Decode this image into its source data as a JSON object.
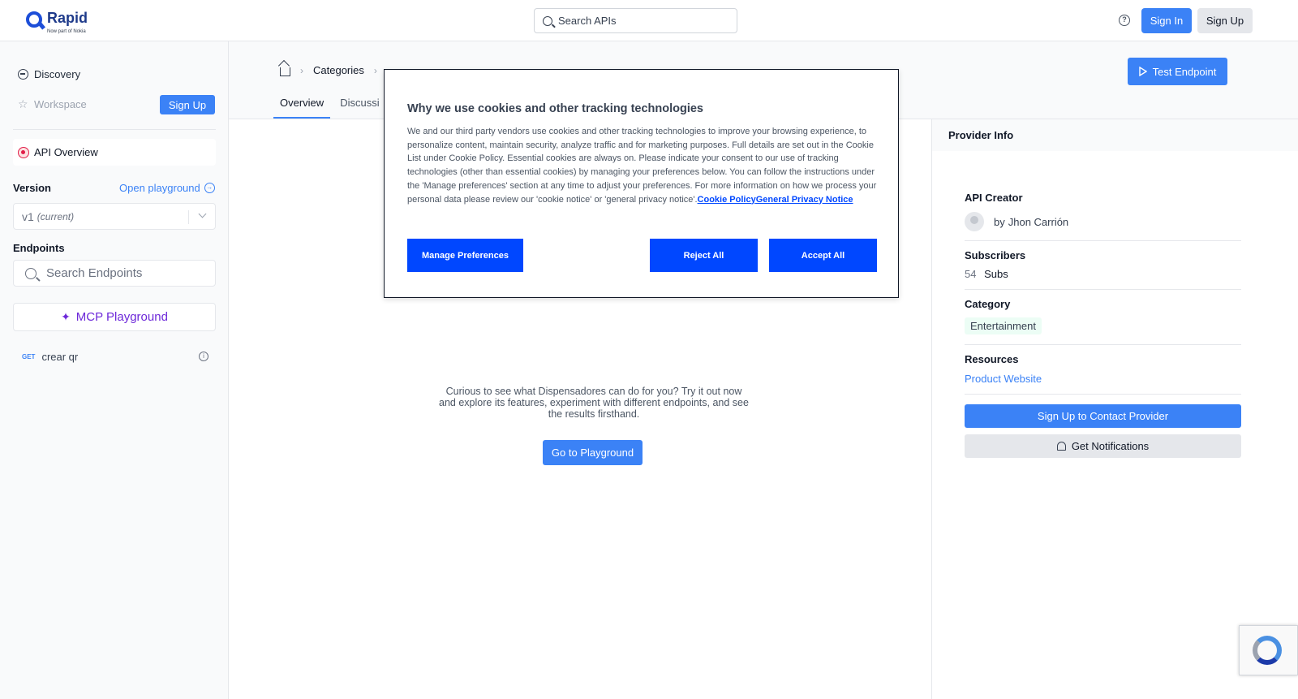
{
  "header": {
    "logo_text": "Rapid",
    "logo_sub": "Now part of Nokia",
    "search_placeholder": "Search APIs",
    "sign_in": "Sign In",
    "sign_up": "Sign Up"
  },
  "sidebar": {
    "discovery": "Discovery",
    "workspace": "Workspace",
    "sign_up": "Sign Up",
    "api_overview": "API Overview",
    "version_label": "Version",
    "open_playground": "Open playground",
    "version_value": "v1",
    "version_note": "(current)",
    "endpoints_label": "Endpoints",
    "endpoint_search_placeholder": "Search Endpoints",
    "mcp_playground": "MCP Playground",
    "endpoints": [
      {
        "method": "GET",
        "name": "crear qr"
      }
    ]
  },
  "main": {
    "breadcrumb_categories": "Categories",
    "tabs": [
      "Overview",
      "Discussi"
    ],
    "test_endpoint": "Test Endpoint",
    "center_text": "Curious to see what Dispensadores can do for you? Try it out now and explore its features, experiment with different endpoints, and see the results firsthand.",
    "go_playground": "Go to Playground"
  },
  "provider": {
    "title": "Provider Info",
    "api_creator_label": "API Creator",
    "creator_by": "by",
    "creator_name": "Jhon Carrión",
    "subscribers_label": "Subscribers",
    "subscribers_count": "54",
    "subscribers_unit": "Subs",
    "category_label": "Category",
    "category_value": "Entertainment",
    "resources_label": "Resources",
    "product_website": "Product Website",
    "contact_button": "Sign Up to Contact Provider",
    "notifications_button": "Get Notifications"
  },
  "cookie": {
    "title": "Why we use cookies and other tracking technologies",
    "body": "We and our third party vendors use cookies and other tracking technologies to improve your browsing experience, to personalize content, maintain security, analyze traffic and for marketing purposes. Full details are set out in the Cookie List under Cookie Policy. Essential cookies are always on. Please indicate your consent to our use of tracking technologies (other than essential cookies) by managing your preferences below. You can follow the instructions under the 'Manage preferences' section at any time to adjust your preferences. For more information on how we process your personal data please review our 'cookie notice' or 'general privacy notice'.",
    "link1": "Cookie Policy",
    "link2": "General Privacy Notice",
    "manage": "Manage Preferences",
    "reject": "Reject All",
    "accept": "Accept All"
  },
  "colors": {
    "primary": "#3b82f6",
    "cookie_blue": "#0047ff",
    "mcp_purple": "#6d28d9"
  }
}
